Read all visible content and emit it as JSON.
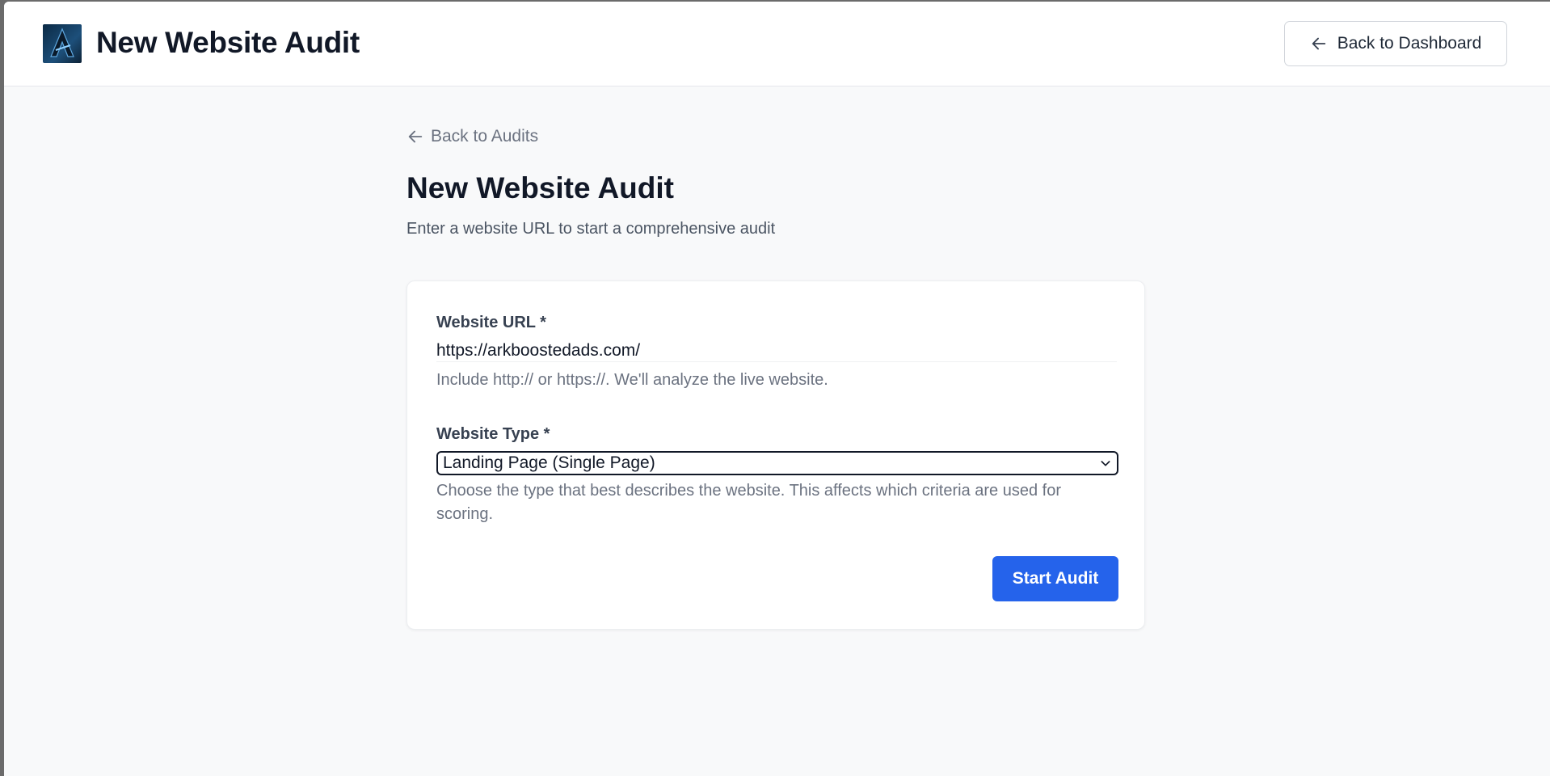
{
  "header": {
    "title": "New Website Audit",
    "back_to_dashboard_label": "Back to Dashboard"
  },
  "main": {
    "back_link_label": "Back to Audits",
    "title": "New Website Audit",
    "subtitle": "Enter a website URL to start a comprehensive audit"
  },
  "form": {
    "url_label": "Website URL *",
    "url_value": "https://arkboostedads.com/",
    "url_hint": "Include http:// or https://. We'll analyze the live website.",
    "type_label": "Website Type *",
    "type_value": "Landing Page (Single Page)",
    "type_hint": "Choose the type that best describes the website. This affects which criteria are used for scoring.",
    "submit_label": "Start Audit"
  },
  "icons": {
    "back_dashboard": "arrow-left-icon",
    "back_audits": "arrow-left-icon",
    "select": "chevron-down-icon",
    "logo": "ark-logo"
  },
  "colors": {
    "primary": "#2563eb",
    "text_dark": "#111827",
    "text_muted": "#6b7280",
    "page_bg": "#f8f9fa"
  }
}
